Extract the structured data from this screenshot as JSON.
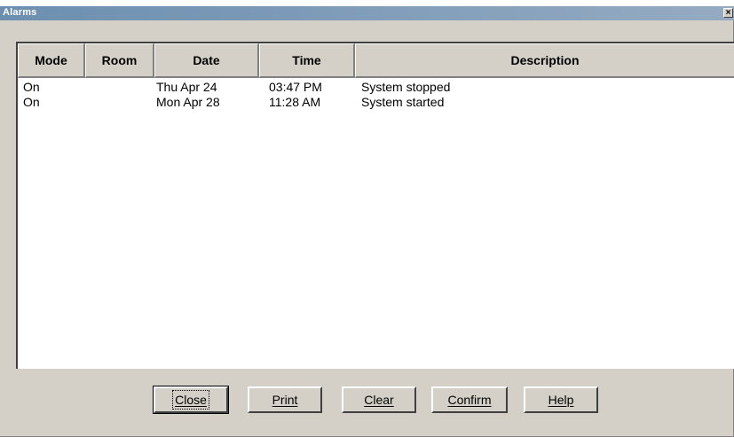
{
  "window": {
    "title": "Alarms",
    "close_glyph": "×"
  },
  "columns": [
    "Mode",
    "Room",
    "Date",
    "Time",
    "Description"
  ],
  "rows": [
    {
      "mode": "On",
      "room": "",
      "date": "Thu Apr 24",
      "time": "03:47 PM",
      "description": "System stopped"
    },
    {
      "mode": "On",
      "room": "",
      "date": "Mon Apr 28",
      "time": "11:28 AM",
      "description": "System started"
    }
  ],
  "buttons": {
    "close": "Close",
    "print": "Print",
    "clear": "Clear",
    "confirm": "Confirm",
    "help": "Help"
  }
}
